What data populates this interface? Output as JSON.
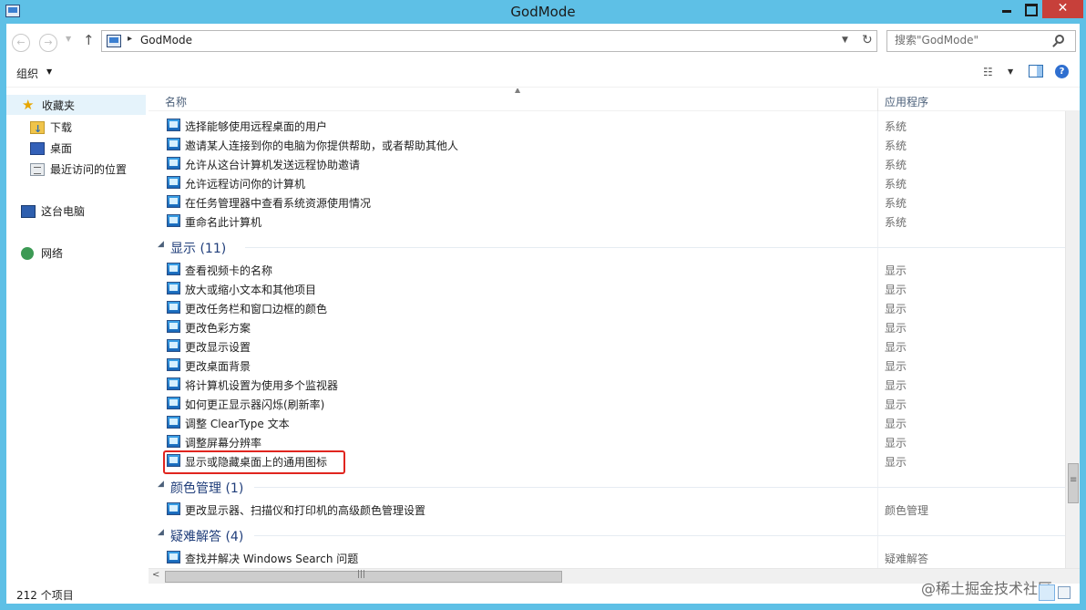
{
  "window": {
    "title": "GodMode",
    "close_glyph": "✕"
  },
  "nav": {
    "back_glyph": "←",
    "forward_glyph": "→",
    "recent_glyph": "▼",
    "up_glyph": "↑",
    "address_sep": "▸",
    "address_text": "GodMode",
    "address_drop": "▼",
    "refresh_glyph": "↻",
    "search_placeholder": "搜索\"GodMode\""
  },
  "toolbar": {
    "organize_label": "组织",
    "organize_caret": "▼",
    "view_glyph": "☷",
    "view_caret": "▼",
    "help_glyph": "?"
  },
  "sidebar": {
    "favorites": {
      "label": "收藏夹",
      "icon": "★"
    },
    "items": [
      {
        "label": "下载"
      },
      {
        "label": "桌面"
      },
      {
        "label": "最近访问的位置"
      }
    ],
    "this_pc": "这台电脑",
    "network": "网络"
  },
  "columns": {
    "name": "名称",
    "sort_glyph": "▲",
    "app": "应用程序"
  },
  "groups": [
    {
      "title": "显示 (11)",
      "caret": "◢"
    },
    {
      "title": "颜色管理 (1)",
      "caret": "◢"
    },
    {
      "title": "疑难解答 (4)",
      "caret": "◢"
    }
  ],
  "rows": [
    {
      "name": "选择能够使用远程桌面的用户",
      "app": "系统"
    },
    {
      "name": "邀请某人连接到你的电脑为你提供帮助，或者帮助其他人",
      "app": "系统"
    },
    {
      "name": "允许从这台计算机发送远程协助邀请",
      "app": "系统"
    },
    {
      "name": "允许远程访问你的计算机",
      "app": "系统"
    },
    {
      "name": "在任务管理器中查看系统资源使用情况",
      "app": "系统"
    },
    {
      "name": "重命名此计算机",
      "app": "系统"
    },
    {
      "name": "查看视频卡的名称",
      "app": "显示"
    },
    {
      "name": "放大或缩小文本和其他项目",
      "app": "显示"
    },
    {
      "name": "更改任务栏和窗口边框的颜色",
      "app": "显示"
    },
    {
      "name": "更改色彩方案",
      "app": "显示"
    },
    {
      "name": "更改显示设置",
      "app": "显示"
    },
    {
      "name": "更改桌面背景",
      "app": "显示"
    },
    {
      "name": "将计算机设置为使用多个监视器",
      "app": "显示"
    },
    {
      "name": "如何更正显示器闪烁(刷新率)",
      "app": "显示"
    },
    {
      "name": "调整 ClearType 文本",
      "app": "显示"
    },
    {
      "name": "调整屏幕分辨率",
      "app": "显示"
    },
    {
      "name": "显示或隐藏桌面上的通用图标",
      "app": "显示"
    },
    {
      "name": "更改显示器、扫描仪和打印机的高级颜色管理设置",
      "app": "颜色管理"
    },
    {
      "name": "查找并解决 Windows Search 问题",
      "app": "疑难解答"
    }
  ],
  "scroll": {
    "left_glyph": "<"
  },
  "status": {
    "count": "212 个项目",
    "watermark": "@稀土掘金技术社区"
  },
  "colors": {
    "frame": "#5ec0e6",
    "close": "#c7403a",
    "highlight": "#e0251f"
  }
}
